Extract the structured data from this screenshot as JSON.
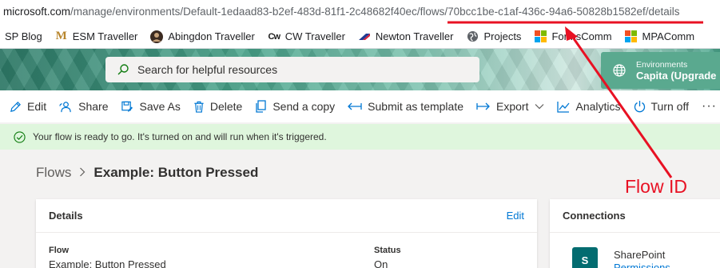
{
  "browser": {
    "url_domain": "microsoft.com",
    "url_path": "/manage/environments/Default-1edaad83-b2ef-483d-81f1-2c48682f40ec/flows/70bcc1be-c1af-436c-94a6-50828b1582ef/details",
    "bookmarks": [
      {
        "label": "SP Blog",
        "icon": "none"
      },
      {
        "label": "ESM Traveller",
        "icon": "m-logo-icon"
      },
      {
        "label": "Abingdon Traveller",
        "icon": "avatar-icon"
      },
      {
        "label": "CW Traveller",
        "icon": "cw-logo-icon"
      },
      {
        "label": "Newton Traveller",
        "icon": "newton-logo-icon"
      },
      {
        "label": "Projects",
        "icon": "globe-icon"
      },
      {
        "label": "FormsComm",
        "icon": "microsoft-logo-icon"
      },
      {
        "label": "MPAComm",
        "icon": "microsoft-logo-icon"
      }
    ]
  },
  "header": {
    "search_placeholder": "Search for helpful resources",
    "environment_label": "Environments",
    "environment_value": "Capita (Upgrade"
  },
  "commands": {
    "edit": "Edit",
    "share": "Share",
    "save_as": "Save As",
    "delete": "Delete",
    "send_copy": "Send a copy",
    "submit_template": "Submit as template",
    "export": "Export",
    "analytics": "Analytics",
    "turn_off": "Turn off",
    "more": "···"
  },
  "message": "Your flow is ready to go. It's turned on and will run when it's triggered.",
  "breadcrumb": {
    "root": "Flows",
    "current": "Example: Button Pressed"
  },
  "details": {
    "title": "Details",
    "edit": "Edit",
    "flow_label": "Flow",
    "flow_value": "Example: Button Pressed",
    "status_label": "Status",
    "status_value": "On"
  },
  "connections": {
    "title": "Connections",
    "item_name": "SharePoint",
    "item_link": "Permissions"
  },
  "annotation": {
    "label": "Flow ID",
    "color": "#e81123"
  },
  "colors": {
    "accent": "#0078d4",
    "success_bg": "#dff6dd",
    "success_icon": "#107c10",
    "env_bg": "#5aa98f"
  }
}
